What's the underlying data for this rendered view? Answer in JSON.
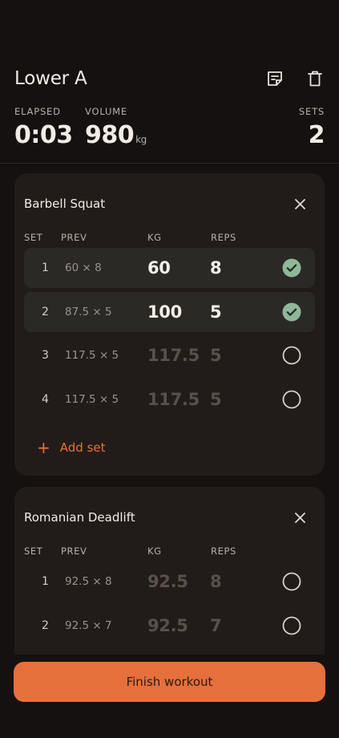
{
  "workout": {
    "title": "Lower A"
  },
  "stats": {
    "elapsed_label": "ELAPSED",
    "elapsed_value": "0:03",
    "volume_label": "VOLUME",
    "volume_value": "980",
    "volume_unit": "kg",
    "sets_label": "SETS",
    "sets_value": "2"
  },
  "columns": {
    "set": "SET",
    "prev": "PREV",
    "kg": "KG",
    "reps": "REPS"
  },
  "exercises": [
    {
      "name": "Barbell Squat",
      "sets": [
        {
          "set": "1",
          "prev": "60 × 8",
          "kg": "60",
          "reps": "8",
          "done": true
        },
        {
          "set": "2",
          "prev": "87.5 × 5",
          "kg": "100",
          "reps": "5",
          "done": true
        },
        {
          "set": "3",
          "prev": "117.5 × 5",
          "kg": "117.5",
          "reps": "5",
          "done": false
        },
        {
          "set": "4",
          "prev": "117.5 × 5",
          "kg": "117.5",
          "reps": "5",
          "done": false
        }
      ],
      "add_set_label": "Add set"
    },
    {
      "name": "Romanian Deadlift",
      "sets": [
        {
          "set": "1",
          "prev": "92.5 × 8",
          "kg": "92.5",
          "reps": "8",
          "done": false
        },
        {
          "set": "2",
          "prev": "92.5 × 7",
          "kg": "92.5",
          "reps": "7",
          "done": false
        }
      ]
    }
  ],
  "finish_label": "Finish workout",
  "colors": {
    "background": "#141110",
    "card": "#211c19",
    "done_row": "#2b2926",
    "accent": "#e5703b",
    "check_done": "#8fb79a"
  },
  "icons": {
    "notes": "notes-icon",
    "delete": "trash-icon",
    "close": "close-icon",
    "done": "check-circle-icon",
    "todo": "empty-circle-icon",
    "add": "plus-icon"
  }
}
